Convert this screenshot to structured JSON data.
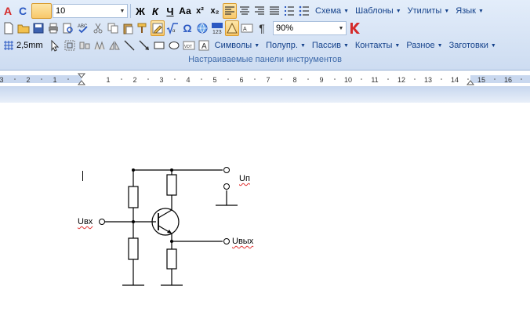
{
  "toolbar": {
    "font_size_value": "10",
    "bold_label": "Ж",
    "italic_label": "К",
    "underline_label": "Ч",
    "case_label": "Аа",
    "superscript_label": "x²",
    "subscript_label": "x₂",
    "menus_row1": [
      "Схема",
      "Шаблоны",
      "Утилиты",
      "Язык"
    ],
    "zoom_value": "90%",
    "menus_row2": [
      "Символы",
      "Полупр.",
      "Пассив",
      "Контакты",
      "Разное",
      "Заготовки"
    ],
    "line_width_value": "2,5mm",
    "pilcrow_label": "¶",
    "omega_label": "Ω",
    "panel_caption": "Настраиваемые панели инструментов"
  },
  "ruler": {
    "numbers": [
      "3",
      "2",
      "1",
      "1",
      "2",
      "3",
      "4",
      "5",
      "6",
      "7",
      "8",
      "9",
      "10",
      "11",
      "12",
      "13",
      "14",
      "15",
      "16"
    ]
  },
  "document": {
    "labels": {
      "u_in": "Uвх",
      "u_p": "Uп",
      "u_out": "Uвых"
    }
  },
  "colors": {
    "ribbon_top": "#e3edfa",
    "ribbon_bottom": "#cddcf1",
    "accent_text": "#15428b",
    "selected_button": "#f8c86a",
    "logo_red": "#d42a2a"
  }
}
